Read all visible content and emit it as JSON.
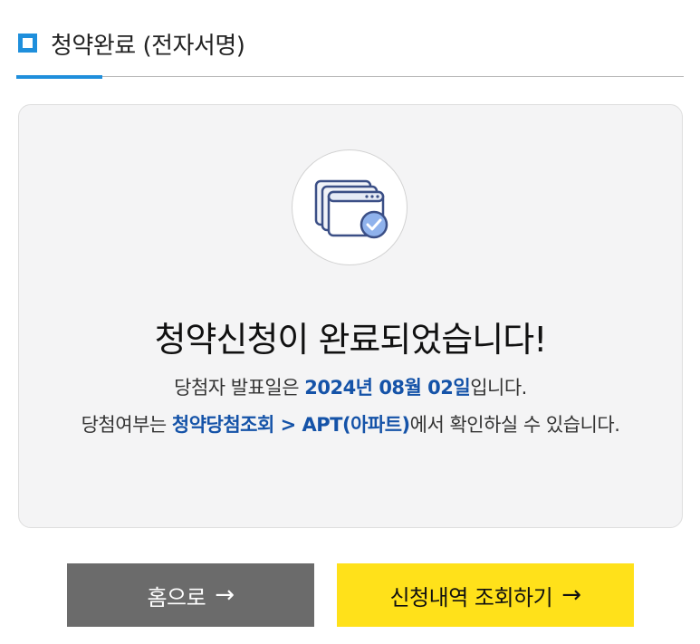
{
  "header": {
    "title": "청약완료 (전자서명)"
  },
  "card": {
    "icon": "document-check-icon",
    "headline": "청약신청이 완료되었습니다!",
    "line1_prefix": "당첨자 발표일은 ",
    "announce_date": "2024년 08월 02일",
    "line1_suffix": "입니다.",
    "line2_prefix": "당첨여부는 ",
    "menu_path": "청약당첨조회 > APT(아파트)",
    "line2_suffix": "에서 확인하실 수 있습니다."
  },
  "buttons": {
    "home_label": "홈으로",
    "history_label": "신청내역 조회하기",
    "arrow": "→"
  },
  "colors": {
    "accent": "#1f8fdc",
    "highlight_text": "#1553a8",
    "home_button": "#6b6b6b",
    "history_button": "#ffe11a"
  }
}
